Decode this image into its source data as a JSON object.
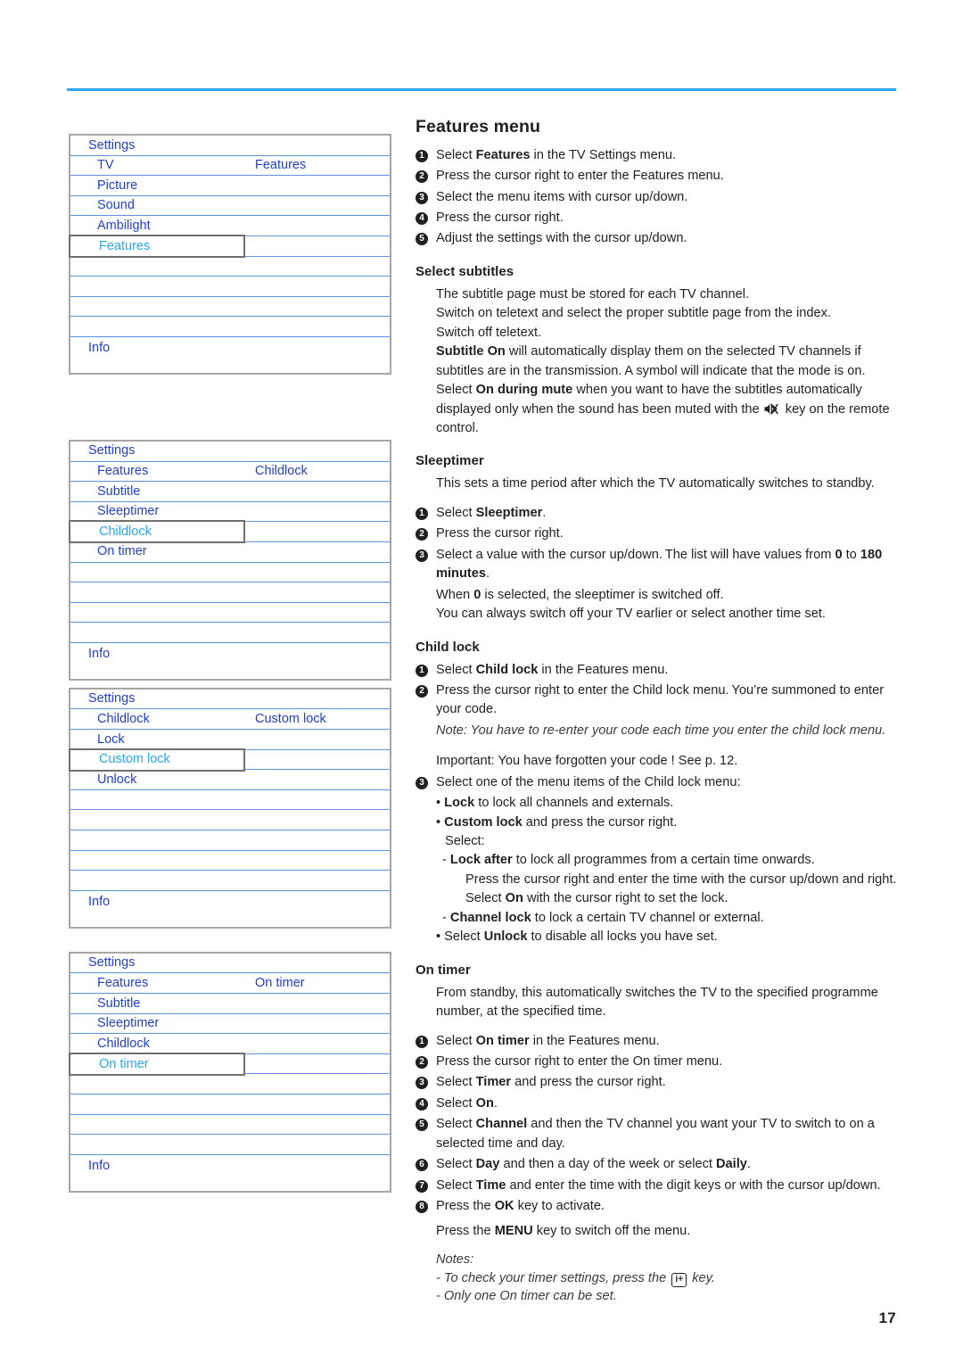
{
  "page": {
    "number": "17",
    "accent_color": "#27a6f5",
    "osd_text_color": "#2341c8",
    "osd_selected_color": "#29a8f0"
  },
  "osd_menus": [
    {
      "name": "features-menu-osd",
      "title": "Settings",
      "rows": [
        {
          "label": "TV",
          "right": "Features",
          "selected": false
        },
        {
          "label": "Picture",
          "right": "",
          "selected": false
        },
        {
          "label": "Sound",
          "right": "",
          "selected": false
        },
        {
          "label": "Ambilight",
          "right": "",
          "selected": false
        },
        {
          "label": "Features",
          "right": "",
          "selected": true
        },
        {
          "label": "",
          "right": "",
          "selected": false
        },
        {
          "label": "",
          "right": "",
          "selected": false
        },
        {
          "label": "",
          "right": "",
          "selected": false
        },
        {
          "label": "",
          "right": "",
          "selected": false
        }
      ],
      "footer": "Info"
    },
    {
      "name": "childlock-menu-osd",
      "title": "Settings",
      "rows": [
        {
          "label": "Features",
          "right": "Childlock",
          "selected": false
        },
        {
          "label": "Subtitle",
          "right": "",
          "selected": false
        },
        {
          "label": "Sleeptimer",
          "right": "",
          "selected": false
        },
        {
          "label": "Childlock",
          "right": "",
          "selected": true
        },
        {
          "label": "On timer",
          "right": "",
          "selected": false
        },
        {
          "label": "",
          "right": "",
          "selected": false
        },
        {
          "label": "",
          "right": "",
          "selected": false
        },
        {
          "label": "",
          "right": "",
          "selected": false
        },
        {
          "label": "",
          "right": "",
          "selected": false
        }
      ],
      "footer": "Info"
    },
    {
      "name": "custom-lock-menu-osd",
      "title": "Settings",
      "rows": [
        {
          "label": "Childlock",
          "right": "Custom lock",
          "selected": false
        },
        {
          "label": "Lock",
          "right": "",
          "selected": false
        },
        {
          "label": "Custom lock",
          "right": "",
          "selected": true
        },
        {
          "label": "Unlock",
          "right": "",
          "selected": false
        },
        {
          "label": "",
          "right": "",
          "selected": false
        },
        {
          "label": "",
          "right": "",
          "selected": false
        },
        {
          "label": "",
          "right": "",
          "selected": false
        },
        {
          "label": "",
          "right": "",
          "selected": false
        },
        {
          "label": "",
          "right": "",
          "selected": false
        }
      ],
      "footer": "Info"
    },
    {
      "name": "on-timer-menu-osd",
      "title": "Settings",
      "rows": [
        {
          "label": "Features",
          "right": "On timer",
          "selected": false
        },
        {
          "label": "Subtitle",
          "right": "",
          "selected": false
        },
        {
          "label": "Sleeptimer",
          "right": "",
          "selected": false
        },
        {
          "label": "Childlock",
          "right": "",
          "selected": false
        },
        {
          "label": "On timer",
          "right": "",
          "selected": true
        },
        {
          "label": "",
          "right": "",
          "selected": false
        },
        {
          "label": "",
          "right": "",
          "selected": false
        },
        {
          "label": "",
          "right": "",
          "selected": false
        },
        {
          "label": "",
          "right": "",
          "selected": false
        }
      ],
      "footer": "Info"
    }
  ],
  "content": {
    "features_menu": {
      "heading": "Features menu",
      "steps": [
        "Select Features in the TV Settings menu.",
        "Press the cursor right to enter the Features menu.",
        "Select the menu items with cursor up/down.",
        "Press the cursor right.",
        "Adjust the settings with the cursor up/down."
      ]
    },
    "select_subtitles": {
      "heading": "Select subtitles",
      "lines": [
        "The subtitle page must be stored for each TV channel.",
        "Switch on teletext and select the proper subtitle page from the index.",
        "Switch off teletext.",
        "Subtitle On will automatically display them on the selected TV channels if subtitles are in the transmission. A symbol will indicate that the mode is on.",
        "Select On during mute when you want to have the subtitles automatically displayed only when the sound has been muted with the [mute] key on the remote control."
      ]
    },
    "sleeptimer": {
      "heading": "Sleeptimer",
      "intro": "This sets a time period after which the TV automatically switches to standby.",
      "steps": [
        "Select Sleeptimer.",
        "Press the cursor right.",
        "Select a value with the cursor up/down. The list will have values from 0 to 180 minutes."
      ],
      "trailing": [
        "When 0 is selected, the sleeptimer is switched off.",
        "You can always switch off your TV earlier or select another time set."
      ]
    },
    "child_lock": {
      "heading": "Child lock",
      "step1": "Select Child lock in the Features menu.",
      "step2": "Press the cursor right to enter the Child lock menu. You're summoned to enter your code.",
      "note": "Note: You have to re-enter your code each time you enter the child lock menu.",
      "important": "Important: You have forgotten your code ! See p. 12.",
      "step3": "Select one of the menu items of the Child lock menu:",
      "bullets": [
        "• Lock to lock all channels and externals.",
        "• Custom lock and press the cursor right.",
        "Select:",
        "- Lock after to lock all programmes from a certain time onwards.",
        "Press the cursor right and enter the time with the cursor up/down and right. Select On with the cursor right to set the lock.",
        "- Channel lock to lock a certain TV channel or external.",
        "• Select Unlock to disable all locks you have set."
      ]
    },
    "on_timer": {
      "heading": "On timer",
      "intro": "From standby, this automatically switches the TV to the specified programme number, at the specified time.",
      "steps": [
        "Select On timer in the Features menu.",
        "Press the cursor right to enter the On timer menu.",
        "Select Timer and press the cursor right.",
        "Select On.",
        "Select Channel and then the TV channel you want your TV to switch to on a selected time and day.",
        "Select Day and then a day of the week or select Daily.",
        "Select Time and enter the time with the digit keys or with the cursor up/down.",
        "Press the OK key to activate."
      ],
      "menu_off": "Press the MENU key to switch off the menu.",
      "notes_label": "Notes:",
      "notes": [
        "- To check your timer settings, press the [i+] key.",
        "- Only one On timer can be set."
      ]
    }
  }
}
